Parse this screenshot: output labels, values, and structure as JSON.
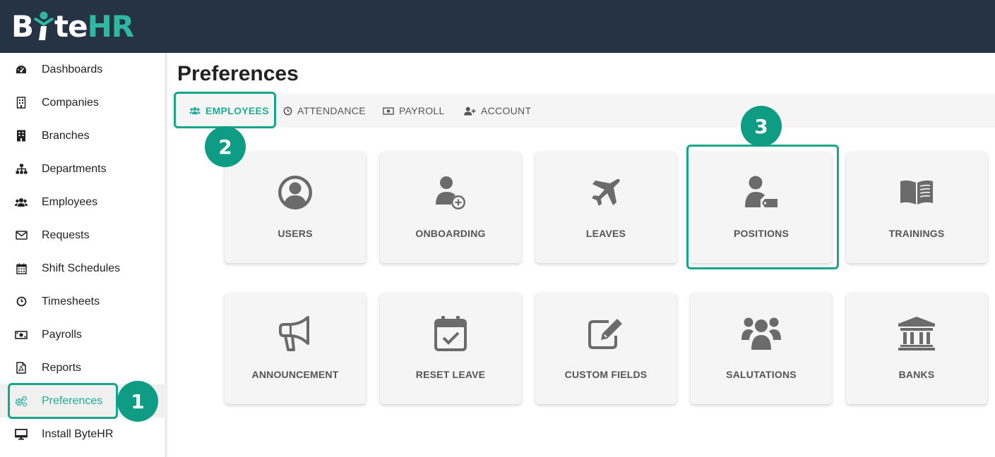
{
  "app": {
    "logo_text_1": "B",
    "logo_text_2": "te",
    "logo_text_3": "HR"
  },
  "sidebar": {
    "items": [
      {
        "label": "Dashboards",
        "icon": "tachometer-icon"
      },
      {
        "label": "Companies",
        "icon": "building-outline-icon"
      },
      {
        "label": "Branches",
        "icon": "building-icon"
      },
      {
        "label": "Departments",
        "icon": "sitemap-icon"
      },
      {
        "label": "Employees",
        "icon": "users-icon"
      },
      {
        "label": "Requests",
        "icon": "envelope-icon"
      },
      {
        "label": "Shift Schedules",
        "icon": "calendar-icon"
      },
      {
        "label": "Timesheets",
        "icon": "clock-icon"
      },
      {
        "label": "Payrolls",
        "icon": "money-bill-icon"
      },
      {
        "label": "Reports",
        "icon": "file-pdf-icon"
      },
      {
        "label": "Preferences",
        "icon": "cogs-icon",
        "active": true
      },
      {
        "label": "Install ByteHR",
        "icon": "desktop-icon"
      }
    ]
  },
  "main": {
    "title": "Preferences",
    "tabs": [
      {
        "label": "EMPLOYEES",
        "icon": "users-icon",
        "active": true
      },
      {
        "label": "ATTENDANCE",
        "icon": "clock-icon"
      },
      {
        "label": "PAYROLL",
        "icon": "money-bill-icon"
      },
      {
        "label": "ACCOUNT",
        "icon": "user-plus-icon"
      }
    ],
    "cards": [
      {
        "label": "USERS",
        "icon": "user-circle-icon"
      },
      {
        "label": "ONBOARDING",
        "icon": "user-plus-icon"
      },
      {
        "label": "LEAVES",
        "icon": "plane-icon"
      },
      {
        "label": "POSITIONS",
        "icon": "user-tag-icon"
      },
      {
        "label": "TRAININGS",
        "icon": "book-open-icon"
      },
      {
        "label": "ANNOUNCEMENT",
        "icon": "bullhorn-icon"
      },
      {
        "label": "RESET LEAVE",
        "icon": "calendar-check-icon"
      },
      {
        "label": "CUSTOM FIELDS",
        "icon": "edit-icon"
      },
      {
        "label": "SALUTATIONS",
        "icon": "users-icon"
      },
      {
        "label": "BANKS",
        "icon": "university-icon"
      }
    ]
  },
  "annotations": {
    "step1": "1",
    "step2": "2",
    "step3": "3"
  },
  "colors": {
    "topbar": "#263345",
    "accent": "#1eab97",
    "annotation": "#0f9c84"
  }
}
